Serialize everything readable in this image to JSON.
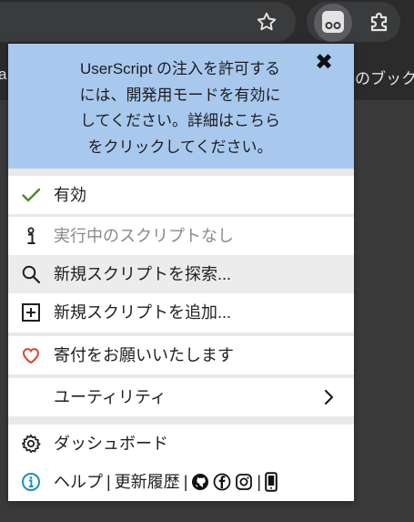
{
  "browser": {
    "bookmark_left": "a",
    "bookmark_right": "のブック"
  },
  "icons": {
    "star": "star-icon",
    "extension": "tampermonkey-icon",
    "puzzle": "puzzle-icon"
  },
  "popup": {
    "notice": {
      "lines": [
        "UserScript の注入を許可する",
        "には、開発用モードを有効に",
        "してください。詳細はこちら",
        "をクリックしてください。"
      ],
      "close": "✖"
    },
    "enabled_label": "有効",
    "no_scripts_label": "実行中のスクリプトなし",
    "find_scripts_label": "新規スクリプトを探索...",
    "add_script_label": "新規スクリプトを追加...",
    "donate_label": "寄付をお願いいたします",
    "utilities_label": "ユーティリティ",
    "dashboard_label": "ダッシュボード",
    "help_label": "ヘルプ",
    "changelog_label": "更新履歴",
    "separator": "|"
  },
  "colors": {
    "notice_bg": "#a9c8ee",
    "check": "#4a8a2a",
    "heart": "#d9452b",
    "info": "#1a8fbf"
  }
}
